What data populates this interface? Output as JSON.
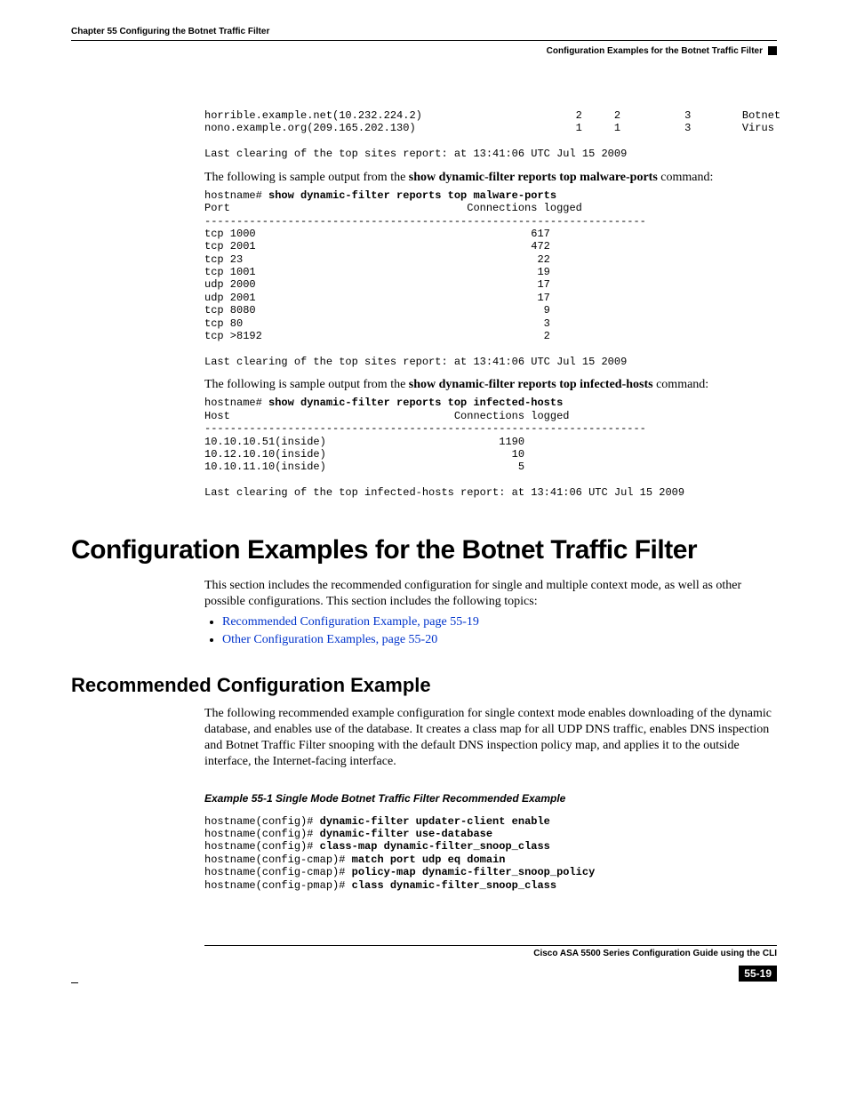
{
  "header": {
    "chapter": "Chapter 55    Configuring the Botnet Traffic Filter",
    "section": "Configuration Examples for the Botnet Traffic Filter"
  },
  "top_sites_tail": "horrible.example.net(10.232.224.2)                        2     2          3        Botnet\nnono.example.org(209.165.202.130)                         1     1          3        Virus\n\nLast clearing of the top sites report: at 13:41:06 UTC Jul 15 2009",
  "para1_a": "The following is sample output from the ",
  "para1_b": "show dynamic-filter reports top malware-ports",
  "para1_c": " command:",
  "malware_ports_block": "hostname# show dynamic-filter reports top malware-ports\nPort                                     Connections logged\n---------------------------------------------------------------------\ntcp 1000                                           617\ntcp 2001                                           472\ntcp 23                                              22\ntcp 1001                                            19\nudp 2000                                            17\nudp 2001                                            17\ntcp 8080                                             9\ntcp 80                                               3\ntcp >8192                                            2\n\nLast clearing of the top sites report: at 13:41:06 UTC Jul 15 2009",
  "malware_ports_prompt": "hostname# ",
  "malware_ports_cmd": "show dynamic-filter reports top malware-ports",
  "malware_ports_rest": "\nPort                                     Connections logged\n---------------------------------------------------------------------\ntcp 1000                                           617\ntcp 2001                                           472\ntcp 23                                              22\ntcp 1001                                            19\nudp 2000                                            17\nudp 2001                                            17\ntcp 8080                                             9\ntcp 80                                               3\ntcp >8192                                            2\n\nLast clearing of the top sites report: at 13:41:06 UTC Jul 15 2009",
  "para2_a": "The following is sample output from the ",
  "para2_b": "show dynamic-filter reports top infected-hosts",
  "para2_c": " command:",
  "infected_prompt": "hostname# ",
  "infected_cmd": "show dynamic-filter reports top infected-hosts",
  "infected_rest": "\nHost                                   Connections logged\n---------------------------------------------------------------------\n10.10.10.51(inside)                           1190\n10.12.10.10(inside)                             10\n10.10.11.10(inside)                              5\n\nLast clearing of the top infected-hosts report: at 13:41:06 UTC Jul 15 2009",
  "h1": "Configuration Examples for the Botnet Traffic Filter",
  "h1_para": "This section includes the recommended configuration for single and multiple context mode, as well as other possible configurations. This section includes the following topics:",
  "links": [
    "Recommended Configuration Example, page 55-19",
    "Other Configuration Examples, page 55-20"
  ],
  "h2": "Recommended Configuration Example",
  "h2_para": "The following recommended example configuration for single context mode enables downloading of the dynamic database, and enables use of the database. It creates a class map for all UDP DNS traffic, enables DNS inspection and Botnet Traffic Filter snooping with the default DNS inspection policy map, and applies it to the outside interface, the Internet-facing interface.",
  "example_title": "Example 55-1   Single Mode Botnet Traffic Filter Recommended Example",
  "cfg_lines": [
    {
      "prompt": "hostname(config)# ",
      "cmd": "dynamic-filter updater-client enable"
    },
    {
      "prompt": "hostname(config)# ",
      "cmd": "dynamic-filter use-database"
    },
    {
      "prompt": "hostname(config)# ",
      "cmd": "class-map dynamic-filter_snoop_class"
    },
    {
      "prompt": "hostname(config-cmap)# ",
      "cmd": "match port udp eq domain"
    },
    {
      "prompt": "hostname(config-cmap)# ",
      "cmd": "policy-map dynamic-filter_snoop_policy"
    },
    {
      "prompt": "hostname(config-pmap)# ",
      "cmd": "class dynamic-filter_snoop_class"
    }
  ],
  "footer": {
    "title": "Cisco ASA 5500 Series Configuration Guide using the CLI",
    "page": "55-19"
  }
}
